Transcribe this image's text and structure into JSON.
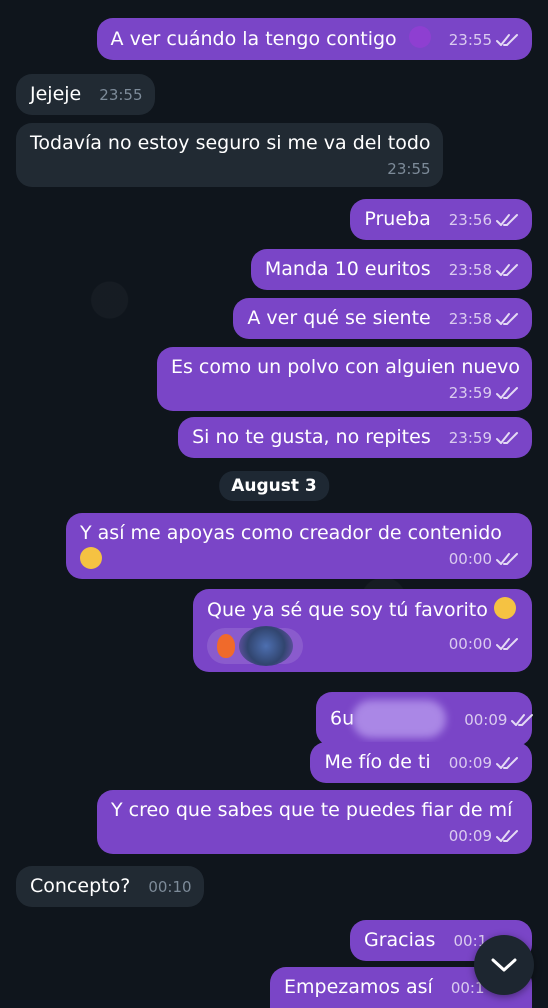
{
  "chat": {
    "date_separator": "August 3",
    "messages": [
      {
        "text": "A ver cuándo la tengo contigo",
        "time": "23:55"
      },
      {
        "text": "Jejeje",
        "time": "23:55"
      },
      {
        "text": "Todavía no estoy seguro si me va del todo",
        "time": "23:55"
      },
      {
        "text": "Prueba",
        "time": "23:56"
      },
      {
        "text": "Manda 10 euritos",
        "time": "23:58"
      },
      {
        "text": "A ver qué se siente",
        "time": "23:58"
      },
      {
        "text": "Es como un polvo con alguien nuevo",
        "time": "23:59"
      },
      {
        "text": "Si no te gusta, no repites",
        "time": "23:59"
      },
      {
        "text": "Y así me apoyas como creador de contenido",
        "time": "00:00"
      },
      {
        "text": "Que ya sé que soy tú favorito",
        "time": "00:00"
      },
      {
        "text": "6u",
        "time": "00:09"
      },
      {
        "text": "Me fío de ti",
        "time": "00:09"
      },
      {
        "text": "Y creo que sabes que te puedes fiar de mí",
        "time": "00:09"
      },
      {
        "text": "Concepto?",
        "time": "00:10"
      },
      {
        "text": "Gracias",
        "time": "00:1"
      },
      {
        "text": "Empezamos así",
        "time": "00:1"
      }
    ]
  },
  "icons": {
    "double_check": "double-check-icon",
    "scroll_down": "chevron-down-icon"
  }
}
